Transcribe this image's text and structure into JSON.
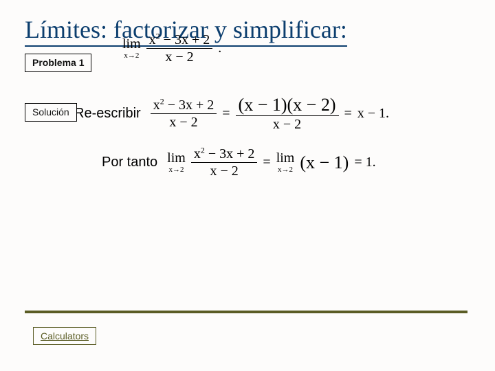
{
  "title": "Límites: factorizar y simplificar:",
  "boxes": {
    "problema": "Problema 1",
    "solucion": "Solución"
  },
  "math": {
    "lim_label": "lim",
    "lim_sub": "x→2",
    "expr_num": "x² − 3x + 2",
    "expr_den": "x − 2",
    "rewrite_label": "Re-escribir",
    "factored_num": "(x − 1)(x − 2)",
    "factored_den": "x − 2",
    "eq": "=",
    "simplified": "x − 1.",
    "therefore_label": "Por tanto",
    "rhs_expr": "(x − 1)",
    "rhs_value": "= 1.",
    "period": "."
  },
  "footer": {
    "calculators": "Calculators"
  }
}
